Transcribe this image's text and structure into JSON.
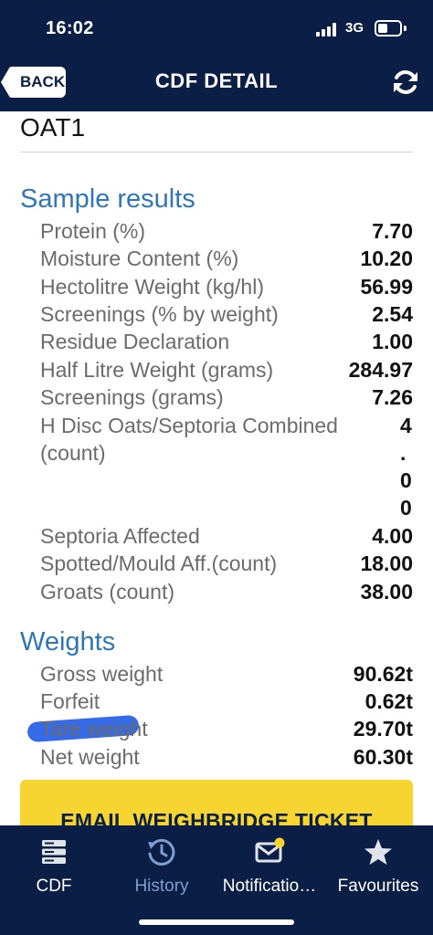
{
  "status_bar": {
    "time": "16:02",
    "network": "3G"
  },
  "header": {
    "back_label": "BACK",
    "title": "CDF DETAIL",
    "refresh_icon": "refresh-icon"
  },
  "farm_code": "OAT1",
  "sample_results": {
    "title": "Sample results",
    "rows": [
      {
        "label": "Protein (%)",
        "value": "7.70"
      },
      {
        "label": "Moisture Content (%)",
        "value": "10.20"
      },
      {
        "label": "Hectolitre Weight (kg/hl)",
        "value": "56.99"
      },
      {
        "label": "Screenings (% by weight)",
        "value": "2.54"
      },
      {
        "label": "Residue Declaration",
        "value": "1.00"
      },
      {
        "label": "Half Litre Weight (grams)",
        "value": "284.97"
      },
      {
        "label": "Screenings (grams)",
        "value": "7.26"
      }
    ],
    "h_disc": {
      "label": "H Disc Oats/Septoria Combined (count)",
      "value_fragments": [
        "4",
        ".",
        "0",
        "0"
      ]
    },
    "rows_after": [
      {
        "label": "Septoria Affected",
        "value": "4.00"
      },
      {
        "label": "Spotted/Mould Aff.(count)",
        "value": "18.00"
      },
      {
        "label": "Groats (count)",
        "value": "38.00"
      }
    ]
  },
  "weights": {
    "title": "Weights",
    "rows": [
      {
        "label": "Gross weight",
        "value": "90.62t"
      },
      {
        "label": "Forfeit",
        "value": "0.62t"
      },
      {
        "label": "Tare weight",
        "value": "29.70t"
      },
      {
        "label": "Net weight",
        "value": "60.30t"
      }
    ]
  },
  "email_button_label": "EMAIL WEIGHBRIDGE TICKET",
  "tabs": [
    {
      "label": "CDF",
      "icon": "server-stack-icon",
      "active": false
    },
    {
      "label": "History",
      "icon": "history-clock-icon",
      "active": true
    },
    {
      "label": "Notificatio…",
      "icon": "envelope-icon",
      "active": false,
      "badge_color": "#f6d531"
    },
    {
      "label": "Favourites",
      "icon": "star-icon",
      "active": false
    }
  ],
  "colors": {
    "navy": "#0b1e45",
    "section_blue": "#2f76b6",
    "button_yellow": "#f6d531",
    "active_tab": "#7b9fd0"
  }
}
